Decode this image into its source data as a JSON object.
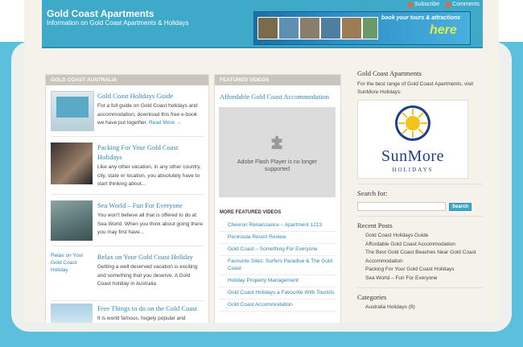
{
  "site": {
    "title": "Gold Coast Apartments",
    "tagline": "Information on Gold Coast Apartments & Holidays",
    "links": [
      "Subscribe",
      "Comments"
    ],
    "banner_text": "book your tours & attractions",
    "banner_here": "here"
  },
  "left_column": {
    "heading": "GOLD COAST AUSTRALIA",
    "posts": [
      {
        "title": "Gold Coast Holidays Guide",
        "excerpt": "For a full guide on Gold Coast holidays and accommodation, download this free e-book we have put together.",
        "read_more": "Read More →"
      },
      {
        "title": "Packing For Your Gold Coast Holidays",
        "excerpt": "Like any other vacation, in any other country, city, state or location, you absolutely have to start thinking about..."
      },
      {
        "title": "Sea World – Fun For Everyone",
        "excerpt": "You won't believe all that is offered to do at Sea World. When you think about going there you may first have..."
      },
      {
        "title": "Relax on Your Gold Coast Holiday",
        "excerpt": "Getting a well deserved vacation is exciting and something that you deserve. A Gold Coast holiday in Australia",
        "image_alt": "Relax on Your Gold Coast Holiday"
      },
      {
        "title": "Free Things to do on the Gold Coast",
        "excerpt": "It is world famous, hugely popular and"
      }
    ]
  },
  "middle_column": {
    "heading": "FEATURED VIDEOS",
    "video_title": "Affordable Gold Coast Accommodation",
    "flash_message": "Adobe Flash Player is no longer supported",
    "more_heading": "MORE FEATURED VIDEOS",
    "more_videos": [
      "Chevron Renaissance – Apartment 1213",
      "Peninsula Resort Review",
      "Gold Coast – Something For Everyone",
      "Favourite Sites: Surfers Paradise & The Gold Coast",
      "Holiday Property Management",
      "Gold Coast Holidays a Favourite With Tourists",
      "Gold Coast Accommodation"
    ]
  },
  "sidebar": {
    "title": "Gold Coast Apartments",
    "intro": "For the best range of Gold Coast Apartments, visit SunMore Holidays:",
    "logo_main": "SunMore",
    "logo_sub": "HOLIDAYS",
    "search_label": "Search for:",
    "search_button": "Search",
    "recent_title": "Recent Posts",
    "recent_posts": [
      "Gold Coast Holidays Guide",
      "Affordable Gold Coast Accommodation",
      "The Best Gold Coast Beaches Near Gold Coast Accommodation",
      "Packing For Your Gold Coast Holidays",
      "Sea World – Fun For Everyone"
    ],
    "categories_title": "Categories",
    "categories": [
      "Australia Holidays (8)"
    ]
  },
  "colors": {
    "header": "#3fa9c9",
    "frame": "#5bc0de",
    "link": "#2e87b5"
  }
}
